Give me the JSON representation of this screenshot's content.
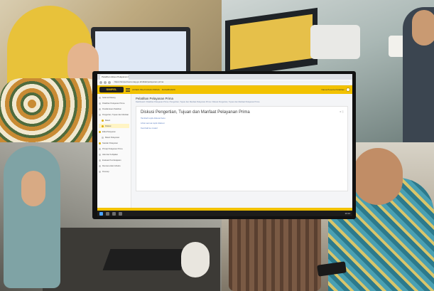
{
  "browser": {
    "tab_title": "Pelatihan Akses Pelayanan Prima",
    "url": "https://simpel.kemenag.go.id/diklat/pelayanan-prima"
  },
  "app": {
    "logo_text": "SIMPEL",
    "header_link_1": "AKSES PELAYANAN PRIMA",
    "header_link_2": "DASHBOARD",
    "user_name": "Nama Peserta Pelatihan"
  },
  "sidebar": {
    "items": [
      {
        "label": "Selamat Datang"
      },
      {
        "label": "Pelatihan Pelayanan Prima"
      },
      {
        "label": "Pendahuluan Pelatihan"
      },
      {
        "label": "Pengertian, Tujuan dan Manfaat"
      },
      {
        "label": "Materi"
      },
      {
        "label": "Diskusi"
      },
      {
        "label": "Etika Pelayanan"
      },
      {
        "label": "Materi Pelayanan"
      },
      {
        "label": "Standar Pelayanan"
      },
      {
        "label": "Prinsip Pelayanan Prima"
      },
      {
        "label": "Aksi dan Kebijakan"
      },
      {
        "label": "Evaluasi Pembelajaran"
      },
      {
        "label": "Rencana Aksi Individu"
      },
      {
        "label": "Penutup"
      }
    ]
  },
  "main": {
    "page_title": "Pelatihan Pelayanan Prima",
    "breadcrumb": "Dashboard / Pelatihan Pelayanan Prima / Pengertian, Tujuan dan Manfaat Pelayanan Prima / Diskusi Pengertian, Tujuan dan Manfaat Pelayanan Prima",
    "card_title": "Diskusi Pengertian, Tujuan dan Manfaat Pelayanan Prima",
    "card_lines": [
      "Tambah topik diskusi baru",
      "Lihat semua topik diskusi",
      "Kembali ke materi"
    ],
    "badge": "0 ⓘ"
  },
  "taskbar": {
    "time": "10:24"
  },
  "colors": {
    "accent": "#f2c200",
    "dark": "#1e1e1e"
  }
}
